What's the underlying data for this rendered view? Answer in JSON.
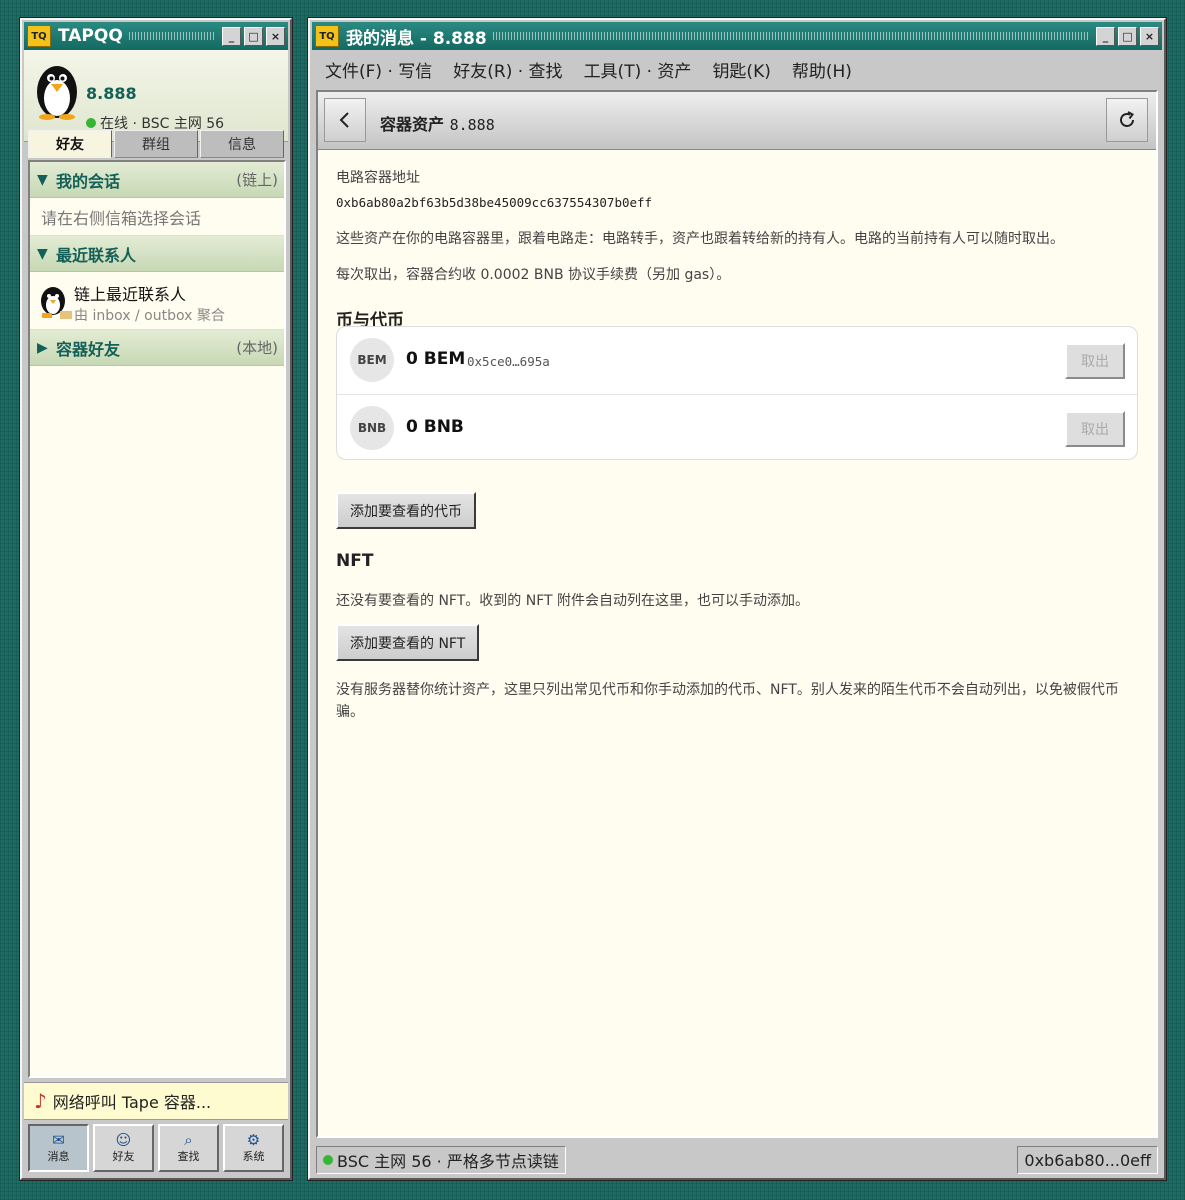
{
  "left_window": {
    "logo": "TQ",
    "title": "TAPQQ",
    "controls": [
      "_",
      "□",
      "×"
    ],
    "profile": {
      "name": "8.888",
      "status": "在线 · BSC 主网 56"
    },
    "tabs": [
      "好友",
      "群组",
      "信息"
    ],
    "groups": {
      "my_sessions": {
        "arrow": "▼",
        "name": "我的会话",
        "note": "(链上)",
        "placeholder": "请在右侧信箱选择会话"
      },
      "recent": {
        "arrow": "▼",
        "name": "最近联系人",
        "contact_name": "链上最近联系人",
        "contact_sub": "由 inbox / outbox 聚合"
      },
      "container_friends": {
        "arrow": "▶",
        "name": "容器好友",
        "note": "(本地)"
      }
    },
    "ticker": {
      "icon": "♪",
      "text": "网络呼叫 Tape 容器..."
    },
    "dock": [
      {
        "icon": "✉",
        "icon_name": "mail-icon",
        "label": "消息"
      },
      {
        "icon": "☺",
        "icon_name": "smiley-icon",
        "label": "好友"
      },
      {
        "icon": "⌕",
        "icon_name": "search-icon",
        "label": "查找"
      },
      {
        "icon": "⚙",
        "icon_name": "gear-icon",
        "label": "系统"
      }
    ]
  },
  "right_window": {
    "logo": "TQ",
    "title": "我的消息 - 8.888",
    "controls": [
      "_",
      "□",
      "×"
    ],
    "menu": [
      "文件(F) · 写信",
      "好友(R) · 查找",
      "工具(T) · 资产",
      "钥匙(K)",
      "帮助(H)"
    ],
    "page": {
      "title": "容器资产",
      "title_value": "8.888",
      "address_label": "电路容器地址",
      "address": "0xb6ab80a2bf63b5d38be45009cc637554307b0eff",
      "para1": "这些资产在你的电路容器里，跟着电路走：电路转手，资产也跟着转给新的持有人。电路的当前持有人可以随时取出。",
      "para2": "每次取出，容器合约收 0.0002 BNB 协议手续费（另加 gas）。",
      "tokens_heading": "币与代币",
      "tokens": [
        {
          "symbol": "BEM",
          "amount": "0 BEM",
          "address": "0x5ce0…695a",
          "action": "取出"
        },
        {
          "symbol": "BNB",
          "amount": "0 BNB",
          "address": "",
          "action": "取出"
        }
      ],
      "add_token_label": "添加要查看的代币",
      "nft_heading": "NFT",
      "nft_desc": "还没有要查看的 NFT。收到的 NFT 附件会自动列在这里，也可以手动添加。",
      "add_nft_label": "添加要查看的 NFT",
      "footer_note": "没有服务器替你统计资产，这里只列出常见代币和你手动添加的代币、NFT。别人发来的陌生代币不会自动列出，以免被假代币骗。"
    },
    "status": {
      "network": "BSC 主网 56 · 严格多节点读链",
      "address_short": "0xb6ab80...0eff"
    }
  },
  "colors": {
    "desktop": "#1d6b63",
    "titlebar": "#146a62",
    "accent_text": "#146058",
    "online": "#34b634",
    "panel_bg": "#fffdf0"
  }
}
